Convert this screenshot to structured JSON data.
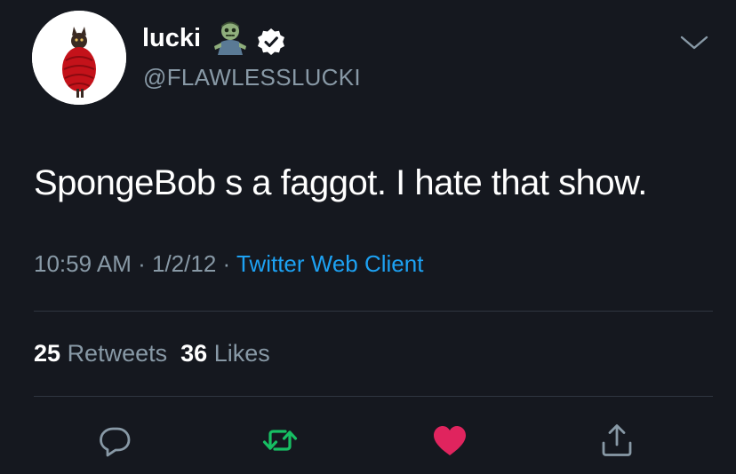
{
  "user": {
    "display_name": "lucki",
    "handle": "@FLAWLESSLUCKI",
    "name_emoji": "zombie-emoji",
    "verified": true
  },
  "tweet": {
    "text": "SpongeBob s a faggot. I hate that show.",
    "time": "10:59 AM",
    "date": "1/2/12",
    "separator": "·",
    "source": "Twitter Web Client"
  },
  "stats": {
    "retweets_count": "25",
    "retweets_label": "Retweets",
    "likes_count": "36",
    "likes_label": "Likes"
  },
  "actions": {
    "reply": "reply-icon",
    "retweet": "retweet-icon",
    "like": "heart-icon",
    "share": "share-icon"
  },
  "colors": {
    "background": "#15181f",
    "text_primary": "#ffffff",
    "text_secondary": "#8899a6",
    "link": "#1da1f2",
    "retweet_green": "#17bf63",
    "like_pink": "#e0245e",
    "divider": "#2f3640"
  }
}
